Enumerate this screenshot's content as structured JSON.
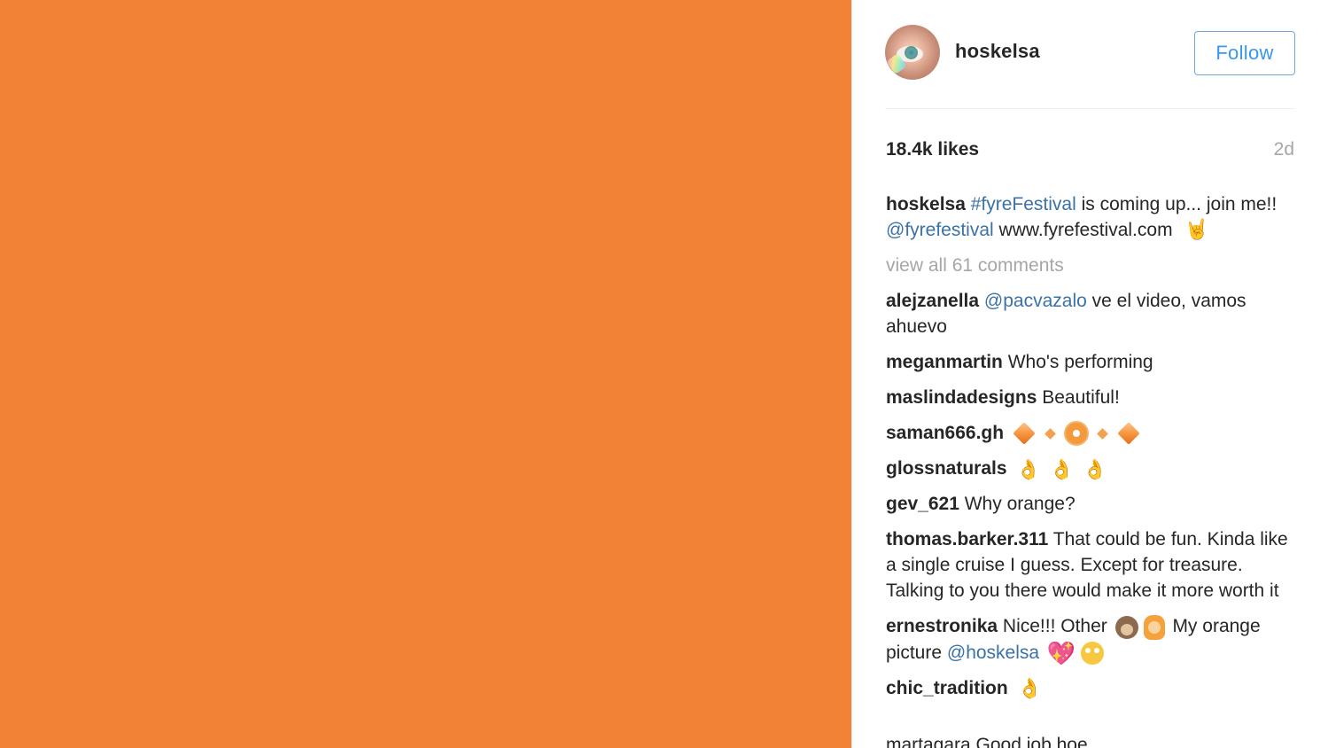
{
  "post": {
    "image_color": "#f28336",
    "author": {
      "username": "hoskelsa",
      "follow_label": "Follow"
    },
    "likes": "18.4k likes",
    "time_ago": "2d",
    "caption": {
      "user": "hoskelsa",
      "hashtag": "#fyreFestival",
      "text_1": " is coming up... join me!! ",
      "mention": "@fyrefestival",
      "text_2": " www.fyrefestival.com "
    },
    "view_all_comments": "view all 61 comments",
    "comments": [
      {
        "user": "alejzanella",
        "mention": "@pacvazalo",
        "text": " ve el video, vamos ahuevo"
      },
      {
        "user": "meganmartin",
        "text": " Who's performing"
      },
      {
        "user": "maslindadesigns",
        "text": " Beautiful!"
      },
      {
        "user": "saman666.gh",
        "emojis": [
          "large-orange-diamond",
          "small-orange-diamond",
          "radioactive-sign",
          "small-orange-diamond",
          "large-orange-diamond"
        ]
      },
      {
        "user": "glossnaturals",
        "emojis": [
          "ok-hand-medium-skin",
          "ok-hand-medium-skin",
          "ok-hand-medium-skin"
        ]
      },
      {
        "user": "gev_621",
        "text": " Why orange?"
      },
      {
        "user": "thomas.barker.311",
        "text": " That could be fun. Kinda like a single cruise I guess. Except for treasure. Talking to you there would make it more worth it"
      },
      {
        "user": "ernestronika",
        "text_1": " Nice!!! Other ",
        "text_2": " My orange picture ",
        "mention": "@hoskelsa"
      },
      {
        "user": "chic_tradition",
        "emojis": [
          "ok-hand"
        ]
      }
    ],
    "cut_off_comment": "martagara Good job hoe"
  },
  "icons": {
    "horns": "🤘",
    "ok_hand": "👌",
    "heart": "💖"
  }
}
